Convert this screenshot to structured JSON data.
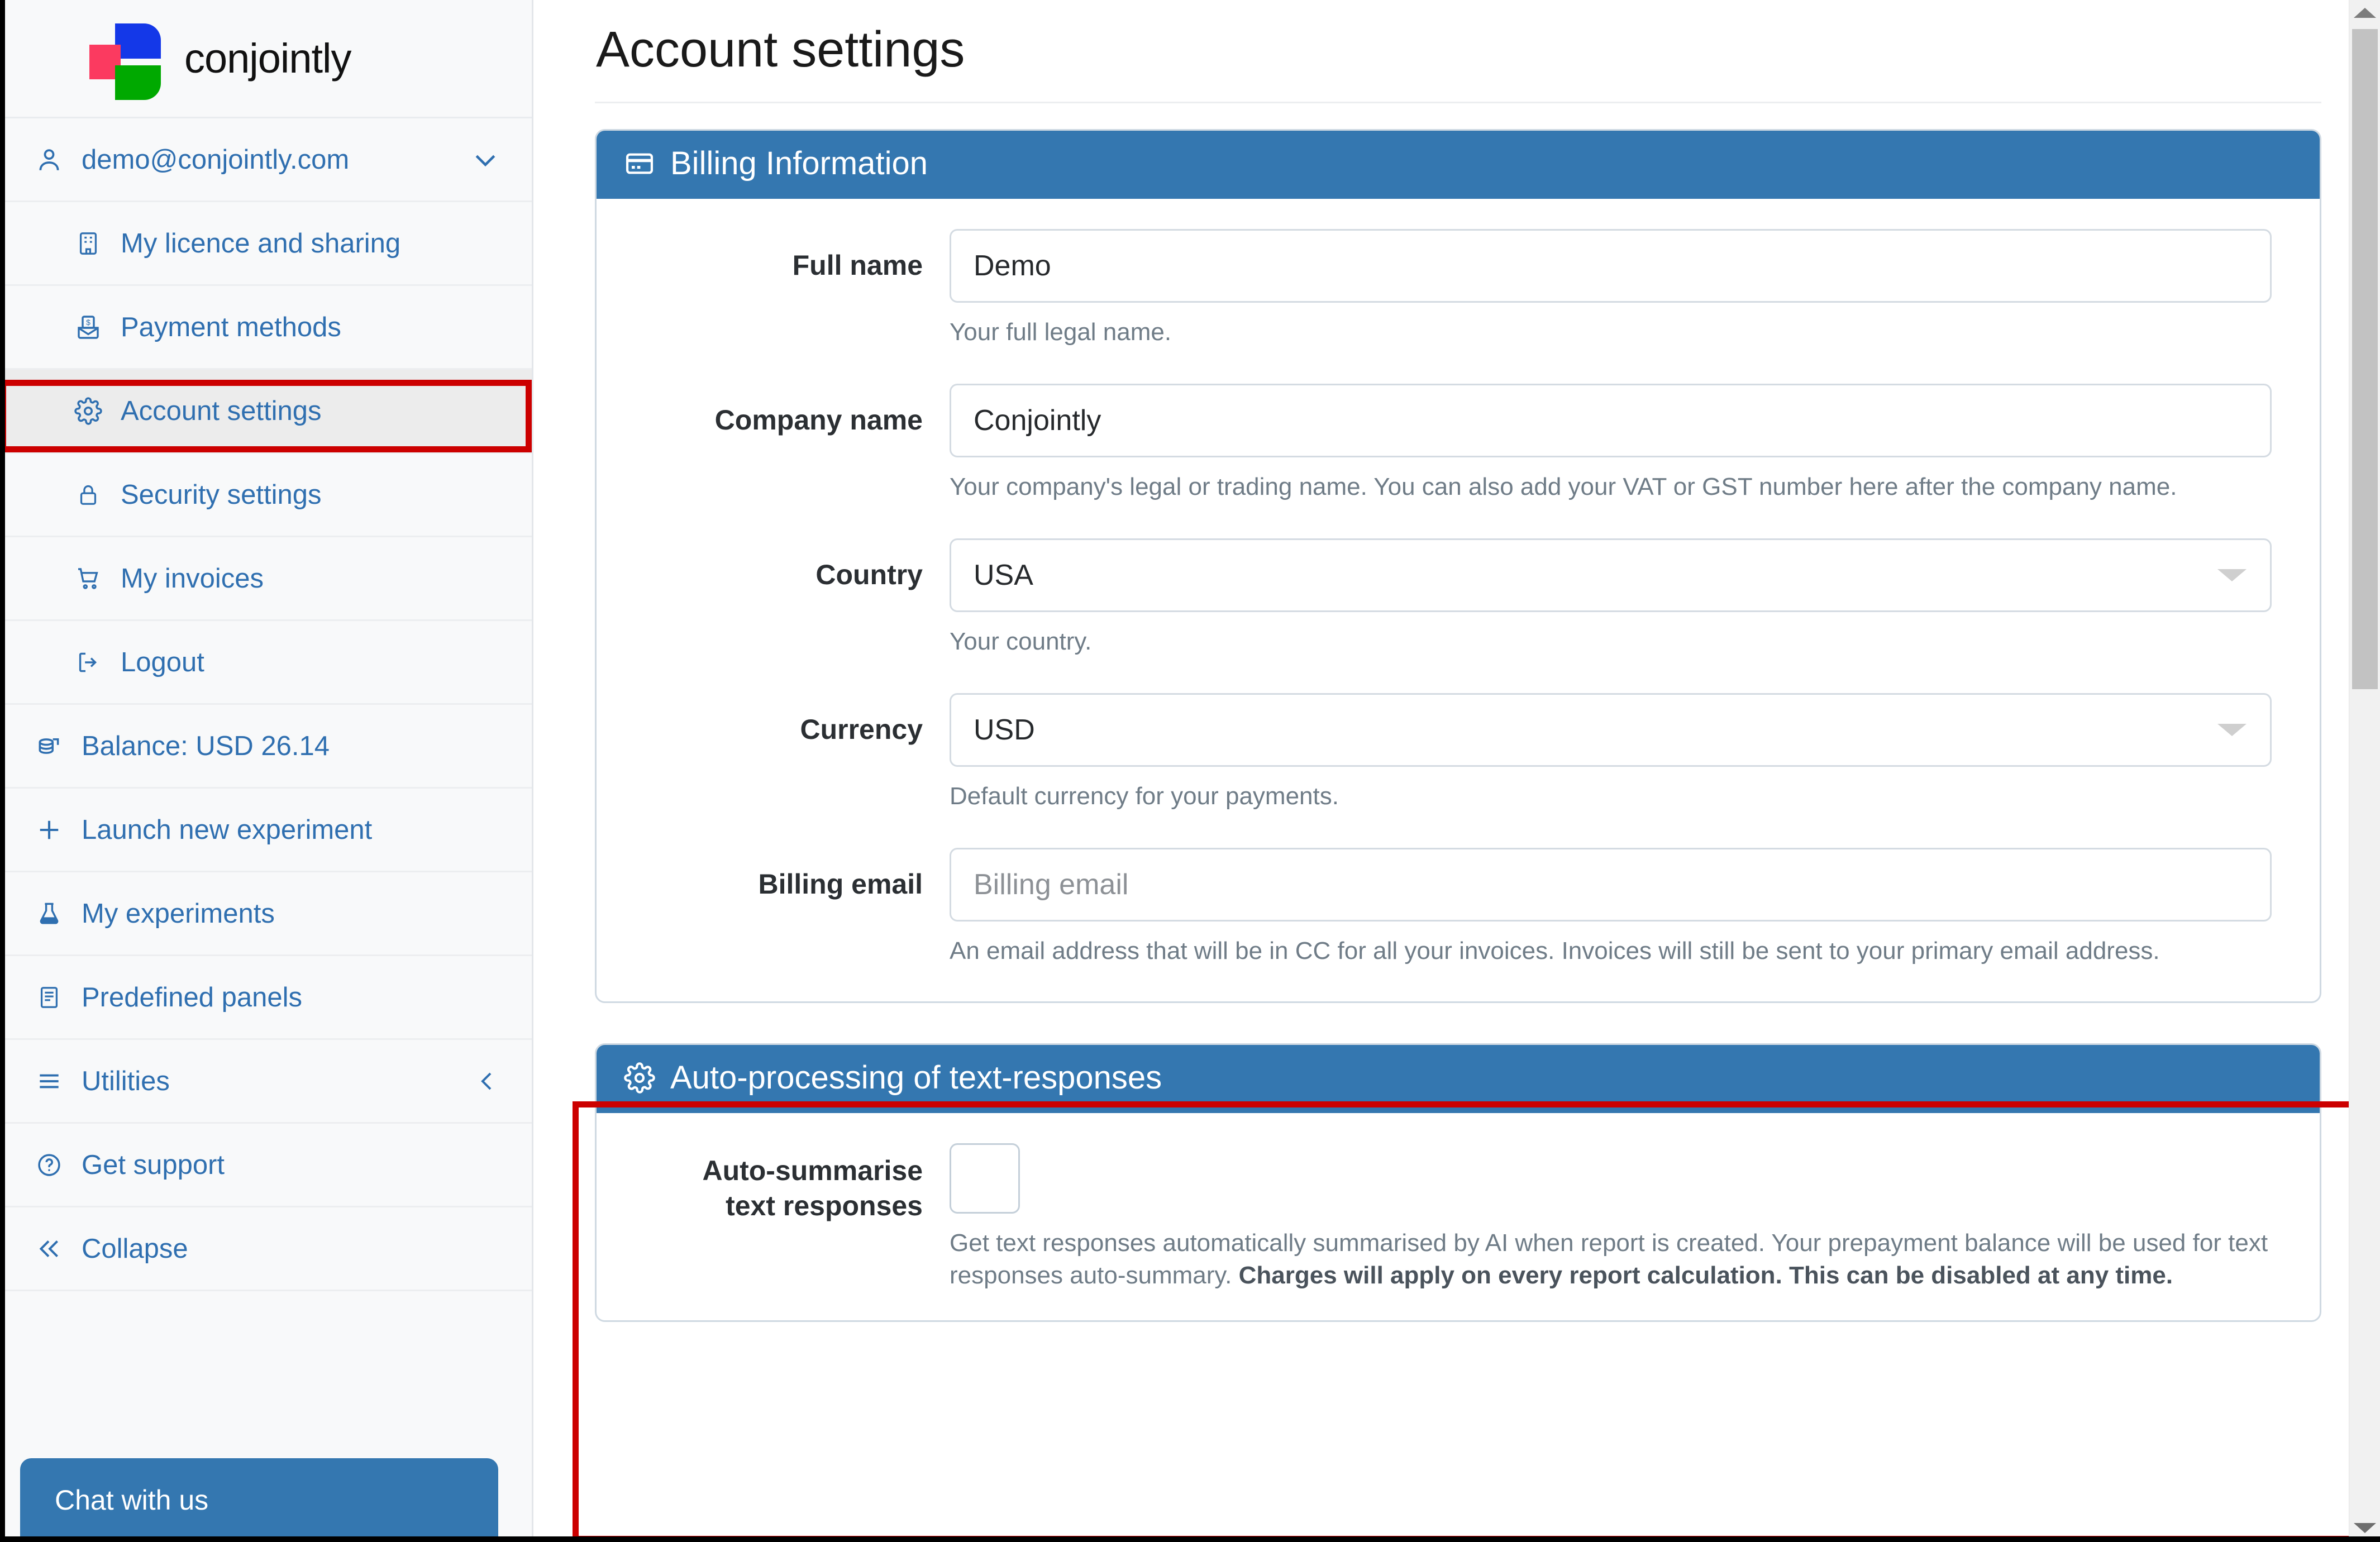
{
  "brand": {
    "name": "conjointly",
    "logo_colors": {
      "blue": "#1438e8",
      "pink": "#fb3a60",
      "green": "#00a900"
    }
  },
  "theme": {
    "accent_blue": "#3477b0",
    "link_blue": "#2f6fb0",
    "highlight_red": "#cc0000",
    "sidebar_bg": "#f8f9fa",
    "active_item_bg": "#ececec"
  },
  "sidebar": {
    "account": {
      "email": "demo@conjointly.com",
      "icon": "user-icon",
      "chevron": "chevron-down-icon"
    },
    "account_submenu": [
      {
        "label": "My licence and sharing",
        "icon": "building-icon"
      },
      {
        "label": "Payment methods",
        "icon": "payment-envelope-icon"
      },
      {
        "label": "Account settings",
        "icon": "gear-icon",
        "active": true
      },
      {
        "label": "Security settings",
        "icon": "lock-icon"
      },
      {
        "label": "My invoices",
        "icon": "cart-icon"
      },
      {
        "label": "Logout",
        "icon": "logout-icon"
      }
    ],
    "balance": {
      "label": "Balance: USD 26.14",
      "icon": "coins-icon"
    },
    "main_items": [
      {
        "label": "Launch new experiment",
        "icon": "plus-icon"
      },
      {
        "label": "My experiments",
        "icon": "flask-icon"
      },
      {
        "label": "Predefined panels",
        "icon": "panel-list-icon"
      },
      {
        "label": "Utilities",
        "icon": "hamburger-icon",
        "trailing_icon": "chevron-left-icon"
      },
      {
        "label": "Get support",
        "icon": "question-circle-icon"
      },
      {
        "label": "Collapse",
        "icon": "double-chevron-left-icon"
      }
    ],
    "chat_button": {
      "label": "Chat with us"
    }
  },
  "main": {
    "page_title": "Account settings",
    "cards": [
      {
        "title": "Billing Information",
        "icon": "credit-card-icon",
        "fields": [
          {
            "label": "Full name",
            "type": "text",
            "value": "Demo",
            "placeholder": "Full name",
            "help": "Your full legal name."
          },
          {
            "label": "Company name",
            "type": "text",
            "value": "Conjointly",
            "placeholder": "Company name",
            "help": "Your company's legal or trading name. You can also add your VAT or GST number here after the company name."
          },
          {
            "label": "Country",
            "type": "select",
            "value": "USA",
            "help": "Your country."
          },
          {
            "label": "Currency",
            "type": "select",
            "value": "USD",
            "help": "Default currency for your payments."
          },
          {
            "label": "Billing email",
            "type": "text",
            "value": "",
            "placeholder": "Billing email",
            "help": "An email address that will be in CC for all your invoices. Invoices will still be sent to your primary email address."
          }
        ]
      },
      {
        "title": "Auto-processing of text-responses",
        "icon": "gear-icon",
        "highlighted": true,
        "fields": [
          {
            "label_line1": "Auto-summarise",
            "label_line2": "text responses",
            "type": "checkbox",
            "checked": false,
            "help_normal_1": "Get text responses automatically summarised by AI when report is created. Your prepayment balance will be used for text responses auto-summary. ",
            "help_bold": "Charges will apply on every report calculation. This can be disabled at any time."
          }
        ]
      }
    ]
  },
  "scrollbar": {
    "up_arrow": "scroll-up-arrow-icon",
    "down_arrow": "scroll-down-arrow-icon"
  }
}
